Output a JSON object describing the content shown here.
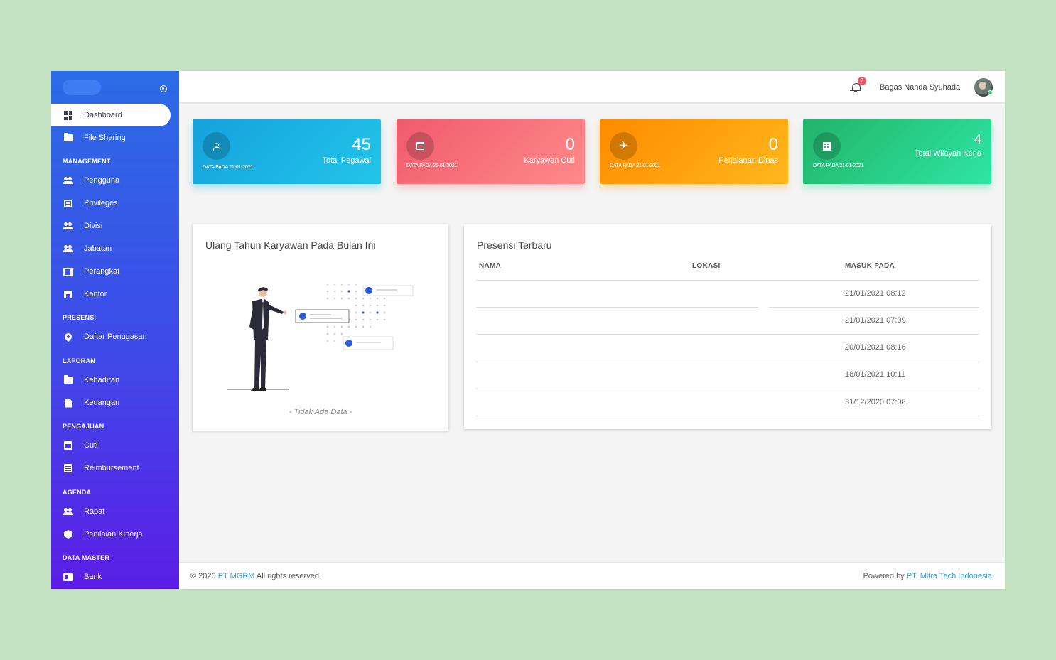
{
  "sidebar": {
    "items": [
      {
        "label": "Dashboard",
        "icon": "dashboard-icon"
      },
      {
        "label": "File Sharing",
        "icon": "folder-icon"
      },
      {
        "label": "Pengguna",
        "icon": "people-icon"
      },
      {
        "label": "Privileges",
        "icon": "privileges-icon"
      },
      {
        "label": "Divisi",
        "icon": "people-icon"
      },
      {
        "label": "Jabatan",
        "icon": "people-icon"
      },
      {
        "label": "Perangkat",
        "icon": "devices-icon"
      },
      {
        "label": "Kantor",
        "icon": "store-icon"
      },
      {
        "label": "Daftar Penugasan",
        "icon": "location-pin-icon"
      },
      {
        "label": "Kehadiran",
        "icon": "folder-icon"
      },
      {
        "label": "Keuangan",
        "icon": "document-icon"
      },
      {
        "label": "Cuti",
        "icon": "calendar-icon"
      },
      {
        "label": "Reimbursement",
        "icon": "list-icon"
      },
      {
        "label": "Rapat",
        "icon": "people-icon"
      },
      {
        "label": "Penilaian Kinerja",
        "icon": "cube-icon"
      },
      {
        "label": "Bank",
        "icon": "bank-icon"
      }
    ],
    "sections": [
      "MANAGEMENT",
      "PRESENSI",
      "LAPORAN",
      "PENGAJUAN",
      "AGENDA",
      "DATA MASTER"
    ]
  },
  "topbar": {
    "notification_count": "7",
    "user_name": "Bagas Nanda Syuhada"
  },
  "cards": [
    {
      "value": "45",
      "label": "Total Pegawai",
      "date": "DATA PADA 21-01-2021",
      "color": "#1ab3e3"
    },
    {
      "value": "0",
      "label": "Karyawan Cuti",
      "date": "DATA PADA 21-01-2021",
      "color": "#f7707c"
    },
    {
      "value": "0",
      "label": "Perjalanan Dinas",
      "date": "DATA PADA 21-01-2021",
      "color": "#ff9f0e"
    },
    {
      "value": "4",
      "label": "Total Wilayah Kerja",
      "date": "DATA PADA 21-01-2021",
      "color": "#28cc86"
    }
  ],
  "birthday_panel": {
    "title": "Ulang Tahun Karyawan Pada Bulan Ini",
    "empty_text": "- Tidak Ada Data -"
  },
  "presence_panel": {
    "title": "Presensi Terbaru",
    "columns": [
      "NAMA",
      "LOKASI",
      "MASUK PADA"
    ],
    "rows": [
      {
        "nama": "",
        "lokasi": "",
        "masuk": "21/01/2021 08:12"
      },
      {
        "nama": "",
        "lokasi": "",
        "masuk": "21/01/2021 07:09"
      },
      {
        "nama": "",
        "lokasi": "",
        "masuk": "20/01/2021 08:16"
      },
      {
        "nama": "",
        "lokasi": "",
        "masuk": "18/01/2021 10:11"
      },
      {
        "nama": "",
        "lokasi": "",
        "masuk": "31/12/2020 07:08"
      }
    ]
  },
  "footer": {
    "copyright_prefix": "© 2020",
    "company": "PT MGRM",
    "rights": "All rights reserved.",
    "powered_prefix": "Powered by",
    "powered_company": "PT. Mitra Tech Indonesia"
  }
}
